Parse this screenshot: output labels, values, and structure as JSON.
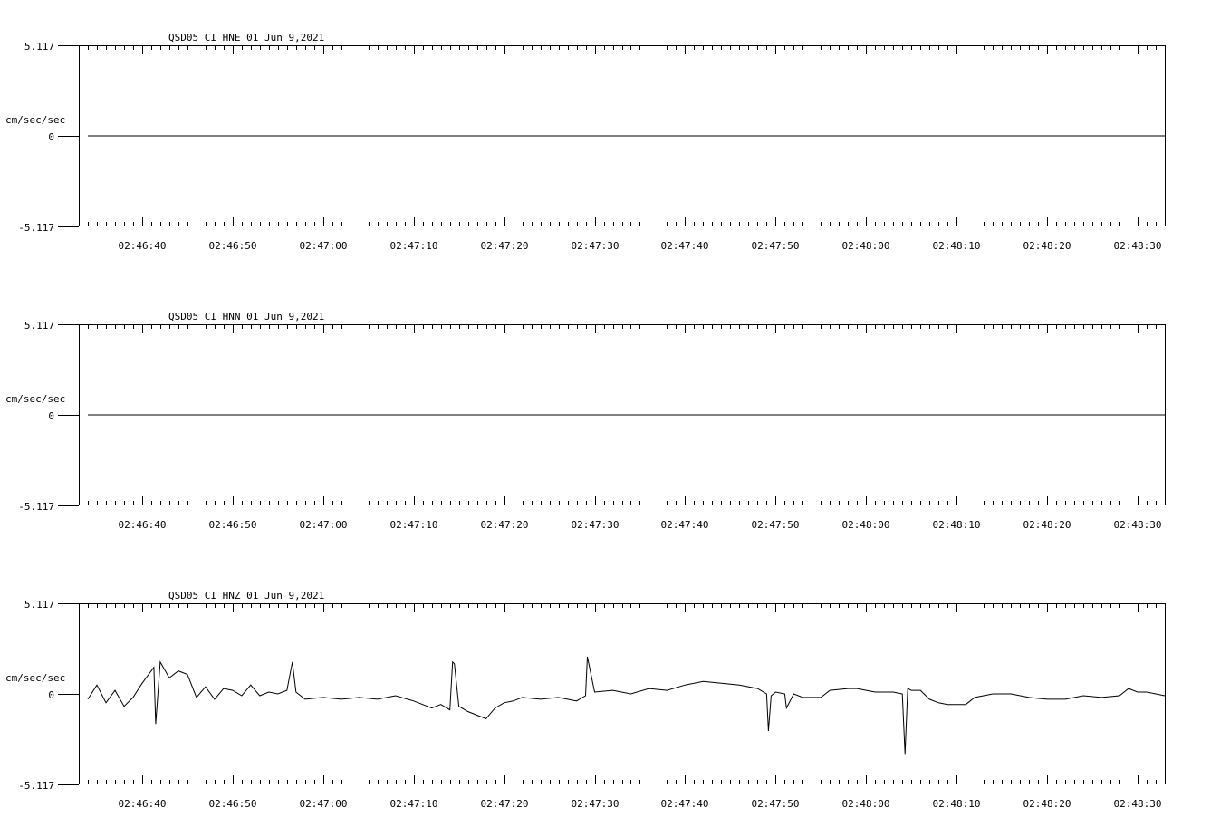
{
  "chart_data": [
    {
      "type": "line",
      "title": "QSD05_CI_HNE_01  Jun 9,2021",
      "ylabel": "cm/sec/sec",
      "ylim": [
        -5.117,
        5.117
      ],
      "yticks": [
        "5.117",
        "0",
        "-5.117"
      ],
      "xtick_labels": [
        "02:46:40",
        "02:46:50",
        "02:47:00",
        "02:47:10",
        "02:47:20",
        "02:47:30",
        "02:47:40",
        "02:47:50",
        "02:48:00",
        "02:48:10",
        "02:48:20",
        "02:48:30"
      ],
      "x_range_seconds": [
        33,
        153
      ],
      "trace_start_seconds": 34,
      "x": [
        34,
        153
      ],
      "y": [
        0,
        0
      ]
    },
    {
      "type": "line",
      "title": "QSD05_CI_HNN_01  Jun 9,2021",
      "ylabel": "cm/sec/sec",
      "ylim": [
        -5.117,
        5.117
      ],
      "yticks": [
        "5.117",
        "0",
        "-5.117"
      ],
      "xtick_labels": [
        "02:46:40",
        "02:46:50",
        "02:47:00",
        "02:47:10",
        "02:47:20",
        "02:47:30",
        "02:47:40",
        "02:47:50",
        "02:48:00",
        "02:48:10",
        "02:48:20",
        "02:48:30"
      ],
      "x_range_seconds": [
        33,
        153
      ],
      "trace_start_seconds": 34,
      "x": [
        34,
        153
      ],
      "y": [
        0,
        0
      ]
    },
    {
      "type": "line",
      "title": "QSD05_CI_HNZ_01  Jun 9,2021",
      "ylabel": "cm/sec/sec",
      "ylim": [
        -5.117,
        5.117
      ],
      "yticks": [
        "5.117",
        "0",
        "-5.117"
      ],
      "xtick_labels": [
        "02:46:40",
        "02:46:50",
        "02:47:00",
        "02:47:10",
        "02:47:20",
        "02:47:30",
        "02:47:40",
        "02:47:50",
        "02:48:00",
        "02:48:10",
        "02:48:20",
        "02:48:30"
      ],
      "x_range_seconds": [
        33,
        153
      ],
      "trace_start_seconds": 34,
      "x": [
        34,
        35,
        36,
        37,
        38,
        39,
        40,
        41.3,
        41.5,
        42,
        43,
        44,
        45,
        46,
        47,
        48,
        49,
        50,
        51,
        52,
        53,
        54,
        55,
        56,
        56.6,
        57,
        58,
        60,
        62,
        64,
        66,
        68,
        70,
        72,
        73,
        74,
        74.3,
        74.5,
        75,
        76,
        77,
        78,
        79,
        80,
        81,
        82,
        84,
        86,
        88,
        89,
        89.2,
        90,
        92,
        94,
        96,
        98,
        100,
        102,
        104,
        106,
        108,
        109,
        109.2,
        109.5,
        110,
        111,
        111.2,
        112,
        113,
        114,
        115,
        116,
        118,
        119,
        120,
        121,
        122,
        123,
        124,
        124.3,
        124.6,
        125,
        126,
        127,
        128,
        129,
        130,
        131,
        132,
        134,
        136,
        138,
        140,
        142,
        144,
        146,
        148,
        149,
        150,
        151,
        152,
        153
      ],
      "y": [
        -0.3,
        0.5,
        -0.5,
        0.2,
        -0.7,
        -0.2,
        0.6,
        1.5,
        -1.7,
        1.8,
        0.9,
        1.3,
        1.1,
        -0.2,
        0.4,
        -0.3,
        0.3,
        0.2,
        -0.1,
        0.5,
        -0.1,
        0.1,
        0,
        0.2,
        1.8,
        0.1,
        -0.3,
        -0.2,
        -0.3,
        -0.2,
        -0.3,
        -0.1,
        -0.4,
        -0.8,
        -0.6,
        -0.9,
        1.8,
        1.7,
        -0.7,
        -1.0,
        -1.2,
        -1.4,
        -0.8,
        -0.5,
        -0.4,
        -0.2,
        -0.3,
        -0.2,
        -0.4,
        -0.1,
        2.1,
        0.1,
        0.2,
        0.0,
        0.3,
        0.2,
        0.5,
        0.7,
        0.6,
        0.5,
        0.3,
        0.0,
        -2.1,
        -0.1,
        0.1,
        0.0,
        -0.8,
        0.0,
        -0.2,
        -0.2,
        -0.2,
        0.2,
        0.3,
        0.3,
        0.2,
        0.1,
        0.1,
        0.1,
        0.0,
        -3.4,
        0.3,
        0.2,
        0.2,
        -0.3,
        -0.5,
        -0.6,
        -0.6,
        -0.6,
        -0.2,
        0.0,
        0.0,
        -0.2,
        -0.3,
        -0.3,
        -0.1,
        -0.2,
        -0.1,
        0.3,
        0.1,
        0.1,
        0.0,
        -0.1
      ]
    }
  ]
}
